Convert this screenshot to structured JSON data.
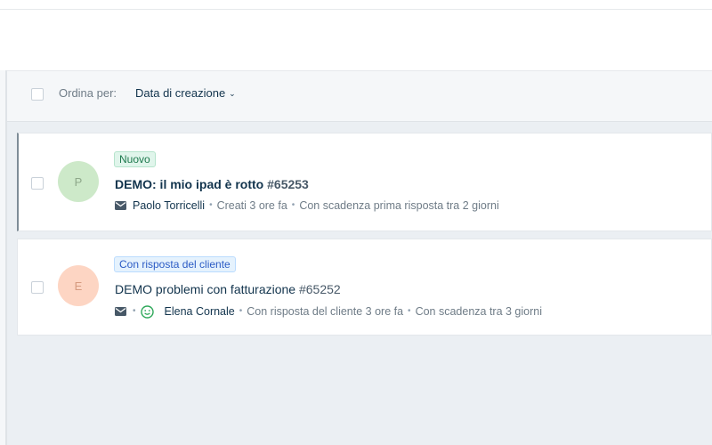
{
  "sort": {
    "label": "Ordina per:",
    "value": "Data di creazione"
  },
  "tickets": [
    {
      "avatar_letter": "P",
      "status": "Nuovo",
      "subject": "DEMO: il mio ipad è rotto",
      "number": "#65253",
      "requester": "Paolo Torricelli",
      "meta_1": "Creati 3 ore fa",
      "meta_2": "Con scadenza prima risposta tra 2 giorni"
    },
    {
      "avatar_letter": "E",
      "status": "Con risposta del cliente",
      "subject": "DEMO problemi con fatturazione",
      "number": "#65252",
      "requester": "Elena Cornale",
      "meta_1": "Con risposta del cliente 3 ore fa",
      "meta_2": "Con scadenza tra 3 giorni"
    }
  ],
  "colors": {
    "new_badge": "#1f7a4f",
    "customer_reply_badge": "#2c5cc5",
    "avatar_1": "#cde9c9",
    "avatar_2": "#fdd5c3"
  }
}
